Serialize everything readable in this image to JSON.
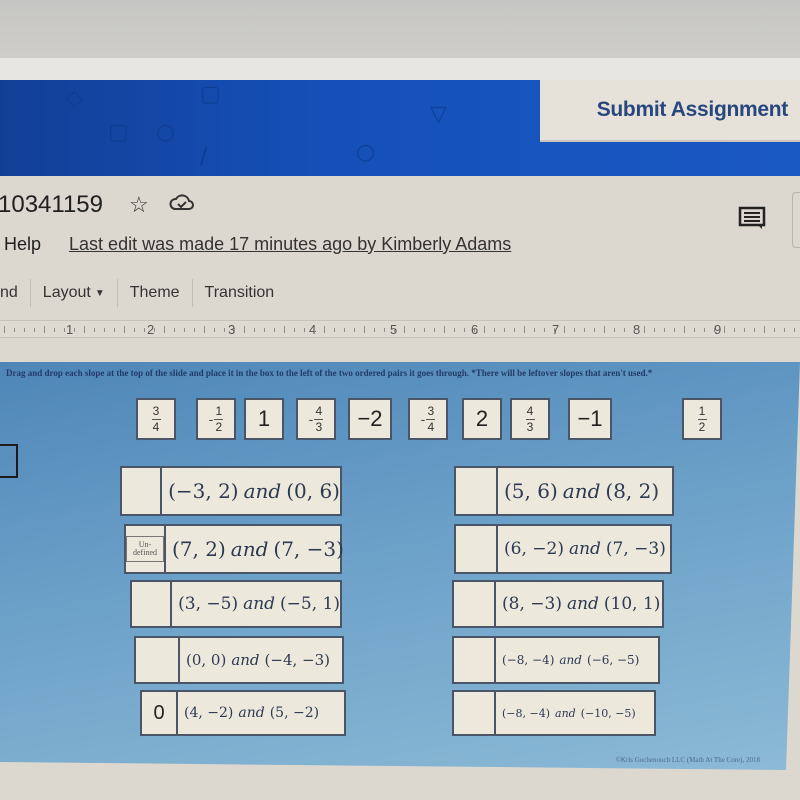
{
  "header": {
    "submit_label": "Submit Assignment"
  },
  "document": {
    "title": "10341159",
    "star_icon": "star-icon",
    "cloud_icon": "cloud-saved-icon",
    "menu_help": "Help",
    "last_edit": "Last edit was made 17 minutes ago by Kimberly Adams",
    "comment_icon": "comment-icon"
  },
  "toolbar": {
    "items": [
      {
        "label": "nd"
      },
      {
        "label": "Layout",
        "dropdown": true
      },
      {
        "label": "Theme"
      },
      {
        "label": "Transition"
      }
    ]
  },
  "ruler": {
    "numbers": [
      "1",
      "2",
      "3",
      "4",
      "5",
      "6",
      "7",
      "8",
      "9"
    ]
  },
  "slide": {
    "instructions": "Drag and drop each slope at the top of the slide and place it in the box to the left of the two ordered pairs it goes through. *There will be leftover slopes that aren't used.*",
    "slopes": [
      {
        "sign": "",
        "num": "3",
        "den": "4"
      },
      {
        "sign": "-",
        "num": "1",
        "den": "2"
      },
      {
        "value": "1"
      },
      {
        "sign": "-",
        "num": "4",
        "den": "3"
      },
      {
        "value": "−2"
      },
      {
        "sign": "-",
        "num": "3",
        "den": "4"
      },
      {
        "value": "2"
      },
      {
        "sign": "",
        "num": "4",
        "den": "3"
      },
      {
        "value": "−1"
      },
      {
        "sign": "",
        "num": "1",
        "den": "2"
      }
    ],
    "pairs_left": [
      {
        "slot": "",
        "p1": "(−3, 2)",
        "p2": "(0, 6)"
      },
      {
        "slot": "Un-defined",
        "p1": "(7, 2)",
        "p2": "(7, −3)"
      },
      {
        "slot": "",
        "p1": "(3, −5)",
        "p2": "(−5, 1)"
      },
      {
        "slot": "",
        "p1": "(0, 0)",
        "p2": "(−4, −3)"
      },
      {
        "slot": "0",
        "p1": "(4, −2)",
        "p2": "(5, −2)"
      }
    ],
    "pairs_right": [
      {
        "slot": "",
        "p1": "(5, 6)",
        "p2": "(8, 2)"
      },
      {
        "slot": "",
        "p1": "(6, −2)",
        "p2": "(7, −3)"
      },
      {
        "slot": "",
        "p1": "(8, −3)",
        "p2": "(10, 1)"
      },
      {
        "slot": "",
        "p1": "(−8, −4)",
        "p2": "(−6, −5)"
      },
      {
        "slot": "",
        "p1": "(−8, −4)",
        "p2": "(−10, −5)"
      }
    ],
    "and_word": "and",
    "copyright": "©Kris Gochenouch LLC (Math At The Core), 2018"
  }
}
